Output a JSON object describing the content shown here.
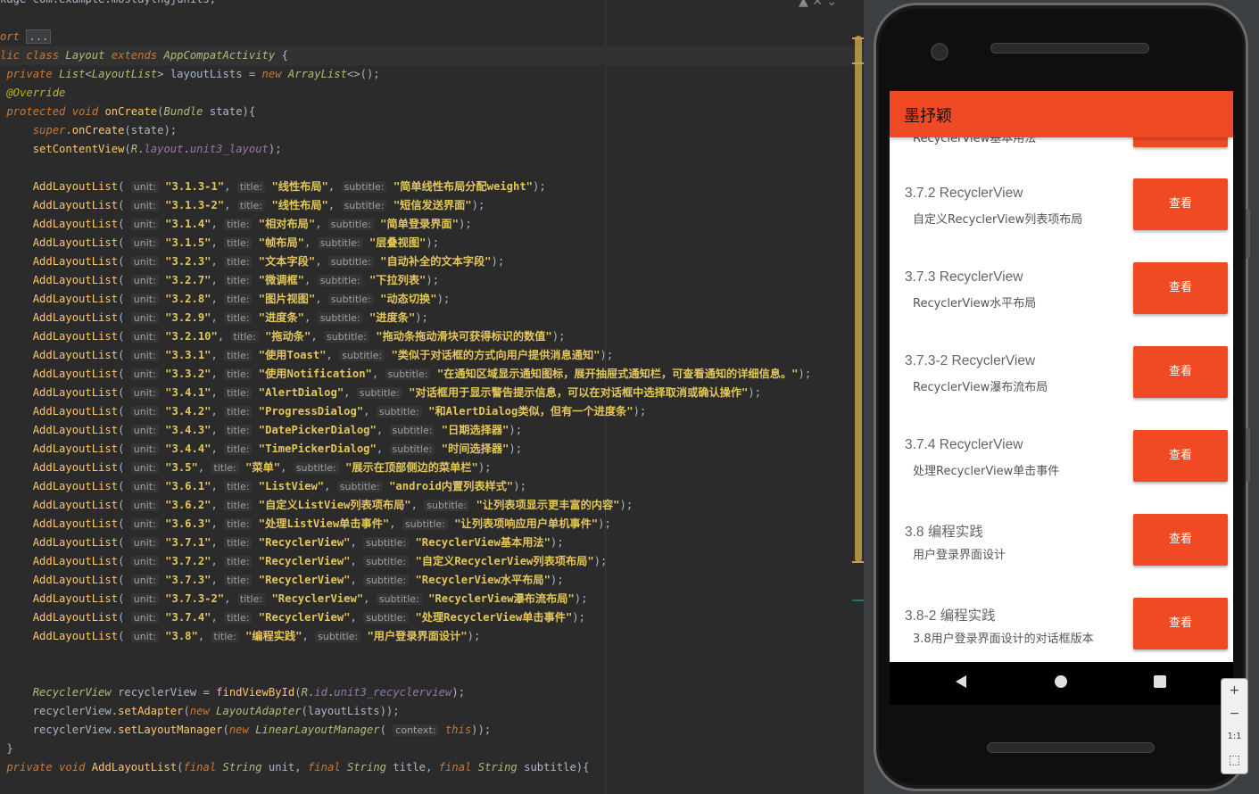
{
  "editor": {
    "lines": [
      {
        "t": "kage com.example.mostaylngjunits;"
      },
      {
        "t": ""
      },
      {
        "t": "ort ..."
      },
      {
        "t": "lic class Layout extends AppCompatActivity {"
      },
      {
        "t": " private List<LayoutList> layoutLists = new ArrayList<>();"
      },
      {
        "t": " @Override"
      },
      {
        "t": " protected void onCreate(Bundle state){"
      },
      {
        "t": "     super.onCreate(state);"
      },
      {
        "t": "     setContentView(R.layout.unit3_layout);"
      },
      {
        "t": ""
      },
      {
        "t": "     AddLayoutList("
      },
      {
        "t": "     AddLayoutList("
      },
      {
        "t": "     AddLayoutList("
      },
      {
        "t": "     AddLayoutList("
      },
      {
        "t": "     AddLayoutList("
      },
      {
        "t": "     AddLayoutList("
      },
      {
        "t": "     AddLayoutList("
      },
      {
        "t": "     AddLayoutList("
      },
      {
        "t": "     AddLayoutList("
      },
      {
        "t": "     AddLayoutList("
      },
      {
        "t": "     AddLayoutList("
      },
      {
        "t": "     AddLayoutList("
      },
      {
        "t": "     AddLayoutList("
      },
      {
        "t": "     AddLayoutList("
      },
      {
        "t": "     AddLayoutList("
      },
      {
        "t": "     AddLayoutList("
      },
      {
        "t": "     AddLayoutList("
      },
      {
        "t": "     AddLayoutList("
      },
      {
        "t": "     AddLayoutList("
      },
      {
        "t": "     AddLayoutList("
      },
      {
        "t": "     AddLayoutList("
      },
      {
        "t": "     AddLayoutList("
      },
      {
        "t": "     AddLayoutList("
      },
      {
        "t": "     AddLayoutList("
      },
      {
        "t": "     AddLayoutList("
      },
      {
        "t": ""
      },
      {
        "t": ""
      },
      {
        "t": "     RecyclerView recyclerView = findViewById(R.id.unit3_recyclerview);"
      },
      {
        "t": "     recyclerView.setAdapter(new LayoutAdapter(layoutLists));"
      },
      {
        "t": "     recyclerView.setLayoutManager(new LinearLayoutManager( context: this));"
      },
      {
        "t": " }"
      },
      {
        "t": " private void AddLayoutList(final String unit, final String title, final String subtitle){"
      }
    ],
    "calls": [
      {
        "unit": "\"3.1.3-1\"",
        "title": "\"线性布局\"",
        "subtitle": "\"简单线性布局分配weight\""
      },
      {
        "unit": "\"3.1.3-2\"",
        "title": "\"线性布局\"",
        "subtitle": "\"短信发送界面\""
      },
      {
        "unit": "\"3.1.4\"",
        "title": "\"相对布局\"",
        "subtitle": "\"简单登录界面\""
      },
      {
        "unit": "\"3.1.5\"",
        "title": "\"帧布局\"",
        "subtitle": "\"层叠视图\""
      },
      {
        "unit": "\"3.2.3\"",
        "title": "\"文本字段\"",
        "subtitle": "\"自动补全的文本字段\""
      },
      {
        "unit": "\"3.2.7\"",
        "title": "\"微调框\"",
        "subtitle": "\"下拉列表\""
      },
      {
        "unit": "\"3.2.8\"",
        "title": "\"图片视图\"",
        "subtitle": "\"动态切换\""
      },
      {
        "unit": "\"3.2.9\"",
        "title": "\"进度条\"",
        "subtitle": "\"进度条\""
      },
      {
        "unit": "\"3.2.10\"",
        "title": "\"拖动条\"",
        "subtitle": "\"拖动条拖动滑块可获得标识的数值\""
      },
      {
        "unit": "\"3.3.1\"",
        "title": "\"使用Toast\"",
        "subtitle": "\"类似于对话框的方式向用户提供消息通知\""
      },
      {
        "unit": "\"3.3.2\"",
        "title": "\"使用Notification\"",
        "subtitle": "\"在通知区域显示通知图标，展开抽屉式通知栏，可查看通知的详细信息。\""
      },
      {
        "unit": "\"3.4.1\"",
        "title": "\"AlertDialog\"",
        "subtitle": "\"对话框用于显示警告提示信息，可以在对话框中选择取消或确认操作\""
      },
      {
        "unit": "\"3.4.2\"",
        "title": "\"ProgressDialog\"",
        "subtitle": "\"和AlertDialog类似，但有一个进度条\""
      },
      {
        "unit": "\"3.4.3\"",
        "title": "\"DatePickerDialog\"",
        "subtitle": "\"日期选择器\""
      },
      {
        "unit": "\"3.4.4\"",
        "title": "\"TimePickerDialog\"",
        "subtitle": "\"时间选择器\""
      },
      {
        "unit": "\"3.5\"",
        "title": "\"菜单\"",
        "subtitle": "\"展示在顶部侧边的菜单栏\""
      },
      {
        "unit": "\"3.6.1\"",
        "title": "\"ListView\"",
        "subtitle": "\"android内置列表样式\""
      },
      {
        "unit": "\"3.6.2\"",
        "title": "\"自定义ListView列表项布局\"",
        "subtitle": "\"让列表项显示更丰富的内容\""
      },
      {
        "unit": "\"3.6.3\"",
        "title": "\"处理ListView单击事件\"",
        "subtitle": "\"让列表项响应用户单机事件\""
      },
      {
        "unit": "\"3.7.1\"",
        "title": "\"RecyclerView\"",
        "subtitle": "\"RecyclerView基本用法\""
      },
      {
        "unit": "\"3.7.2\"",
        "title": "\"RecyclerView\"",
        "subtitle": "\"自定义RecyclerView列表项布局\""
      },
      {
        "unit": "\"3.7.3\"",
        "title": "\"RecyclerView\"",
        "subtitle": "\"RecyclerView水平布局\""
      },
      {
        "unit": "\"3.7.3-2\"",
        "title": "\"RecyclerView\"",
        "subtitle": "\"RecyclerView瀑布流布局\""
      },
      {
        "unit": "\"3.7.4\"",
        "title": "\"RecyclerView\"",
        "subtitle": "\"处理RecyclerView单击事件\""
      },
      {
        "unit": "\"3.8\"",
        "title": "\"编程实践\"",
        "subtitle": "\"用户登录界面设计\""
      },
      {
        "unit": "\"3.8-2\"",
        "title": "\"编程实践\"",
        "subtitle": "\"3.8用户登录界面设计的对话框版本\""
      }
    ],
    "hints": {
      "unit": "unit:",
      "title": "title:",
      "subtitle": "subtitle:"
    },
    "call_tail": ");"
  },
  "app": {
    "title": "墨抒颖",
    "partial_item_sub": "RecyclerView基本用法",
    "items": [
      {
        "title": "3.7.2 RecyclerView",
        "subtitle": "自定义RecyclerView列表项布局",
        "button": "查看"
      },
      {
        "title": "3.7.3 RecyclerView",
        "subtitle": "RecyclerView水平布局",
        "button": "查看"
      },
      {
        "title": "3.7.3-2 RecyclerView",
        "subtitle": "RecyclerView瀑布流布局",
        "button": "查看"
      },
      {
        "title": "3.7.4 RecyclerView",
        "subtitle": "处理RecyclerView单击事件",
        "button": "查看"
      },
      {
        "title": "3.8 编程实践",
        "subtitle": "用户登录界面设计",
        "button": "查看"
      },
      {
        "title": "3.8-2 编程实践",
        "subtitle": "3.8用户登录界面设计的对话框版本",
        "button": "查看"
      }
    ]
  },
  "zoom": {
    "plus": "+",
    "minus": "−",
    "ratio": "1:1",
    "fit": "⬚"
  },
  "colors": {
    "accent": "#f04a25",
    "editor_bg": "#2b2b2b",
    "string": "#e3c65a"
  }
}
